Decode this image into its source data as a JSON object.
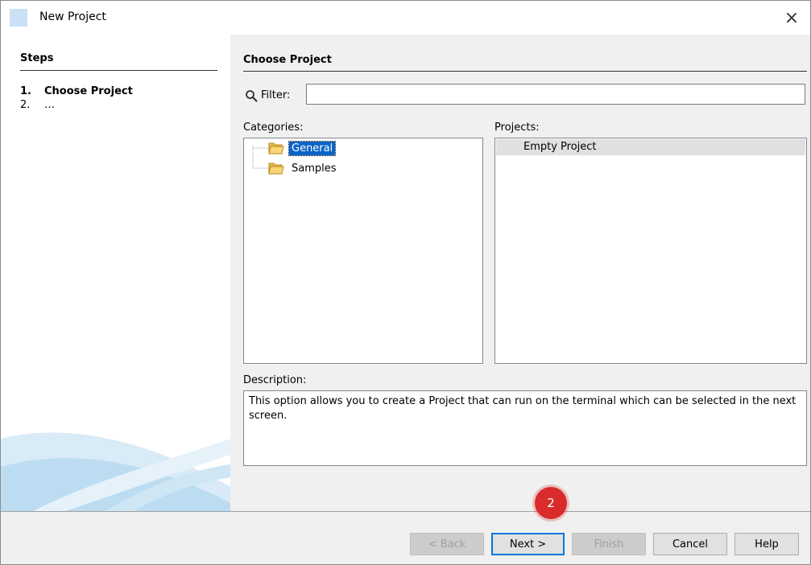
{
  "window": {
    "title": "New Project",
    "close_symbol": "×"
  },
  "steps": {
    "header": "Steps",
    "items": [
      {
        "num": "1.",
        "label": "Choose Project"
      },
      {
        "num": "2.",
        "label": "…"
      }
    ]
  },
  "main": {
    "title": "Choose Project",
    "filter": {
      "icon": "search-icon",
      "label": "Filter:",
      "value": ""
    },
    "categories": {
      "label": "Categories:",
      "items": [
        {
          "label": "General",
          "icon": "folder-icon",
          "selected": true
        },
        {
          "label": "Samples",
          "icon": "folder-icon",
          "selected": false
        }
      ]
    },
    "projects": {
      "label": "Projects:",
      "items": [
        {
          "label": "Empty Project",
          "selected": true
        }
      ]
    },
    "description": {
      "label": "Description:",
      "text": "This option allows you to create a Project that can run on the terminal which can be selected in the next screen."
    }
  },
  "footer": {
    "back_label": "< Back",
    "next_label": "Next >",
    "finish_label": "Finish",
    "cancel_label": "Cancel",
    "help_label": "Help"
  },
  "annotation": {
    "badge_number": "2"
  },
  "colors": {
    "selection": "#0a64c8",
    "badge": "#d92b2b",
    "default_button_border": "#0078d7"
  }
}
